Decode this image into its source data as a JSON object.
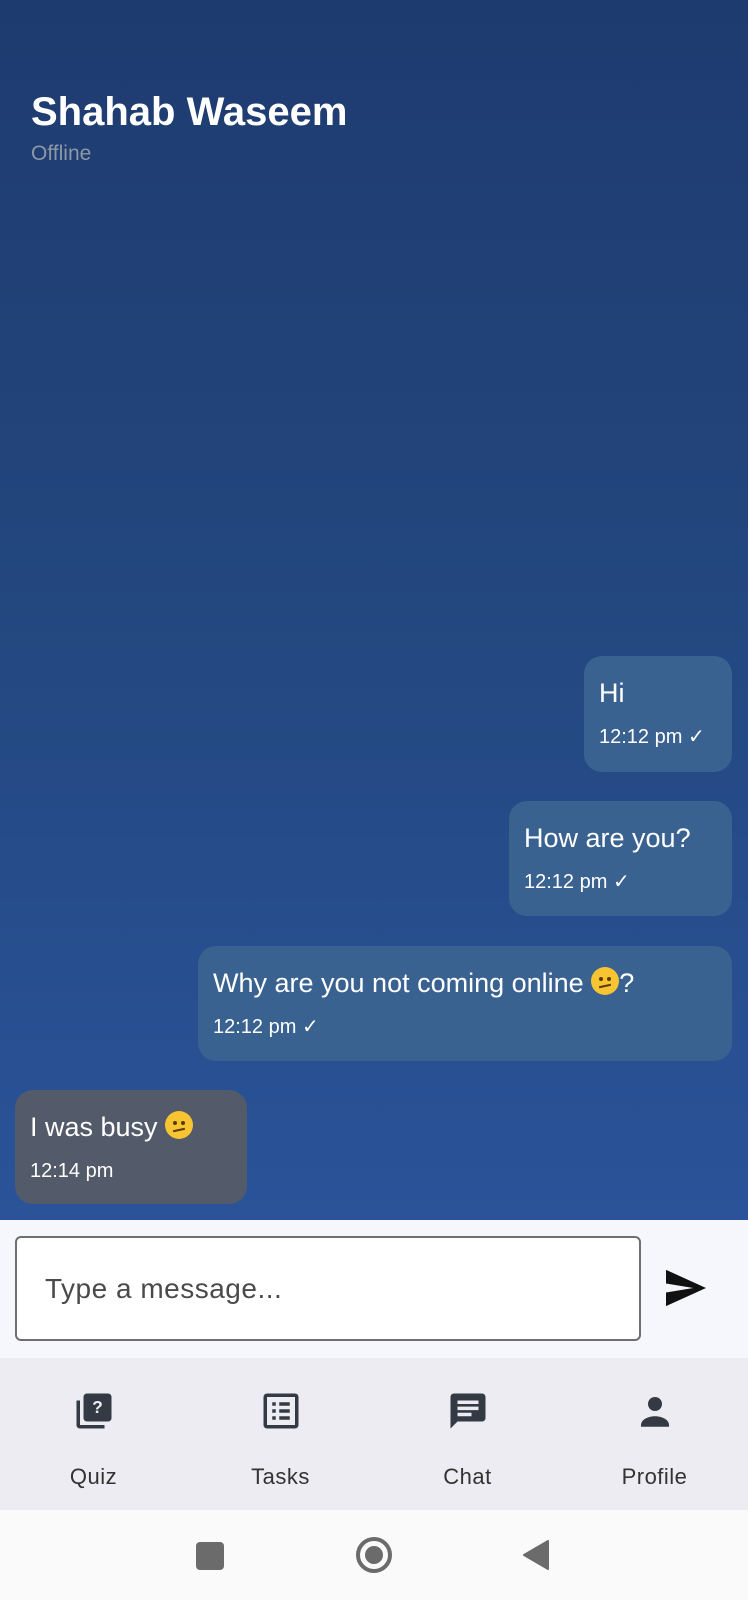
{
  "contact": {
    "name": "Shahab Waseem",
    "status": "Offline"
  },
  "messages": [
    {
      "direction": "sent",
      "text": "Hi",
      "time": "12:12 pm ✓"
    },
    {
      "direction": "sent",
      "text": "How are you?",
      "time": "12:12 pm ✓"
    },
    {
      "direction": "sent",
      "text": "Why are you not coming online",
      "suffix": "?",
      "emoji": "pensive-face",
      "time": "12:12 pm ✓"
    },
    {
      "direction": "received",
      "text": "I was busy",
      "emoji": "confused-face",
      "time": "12:14 pm"
    }
  ],
  "composer": {
    "placeholder": "Type a message..."
  },
  "bottom_nav": {
    "items": [
      {
        "label": "Quiz",
        "icon": "quiz-icon"
      },
      {
        "label": "Tasks",
        "icon": "list-icon"
      },
      {
        "label": "Chat",
        "icon": "chat-icon"
      },
      {
        "label": "Profile",
        "icon": "person-icon"
      }
    ]
  },
  "colors": {
    "chat_bg_top": "#1e3b6f",
    "chat_bg_bottom": "#2a5399",
    "sent_bubble": "#3a6290",
    "received_bubble": "#535b6a"
  }
}
